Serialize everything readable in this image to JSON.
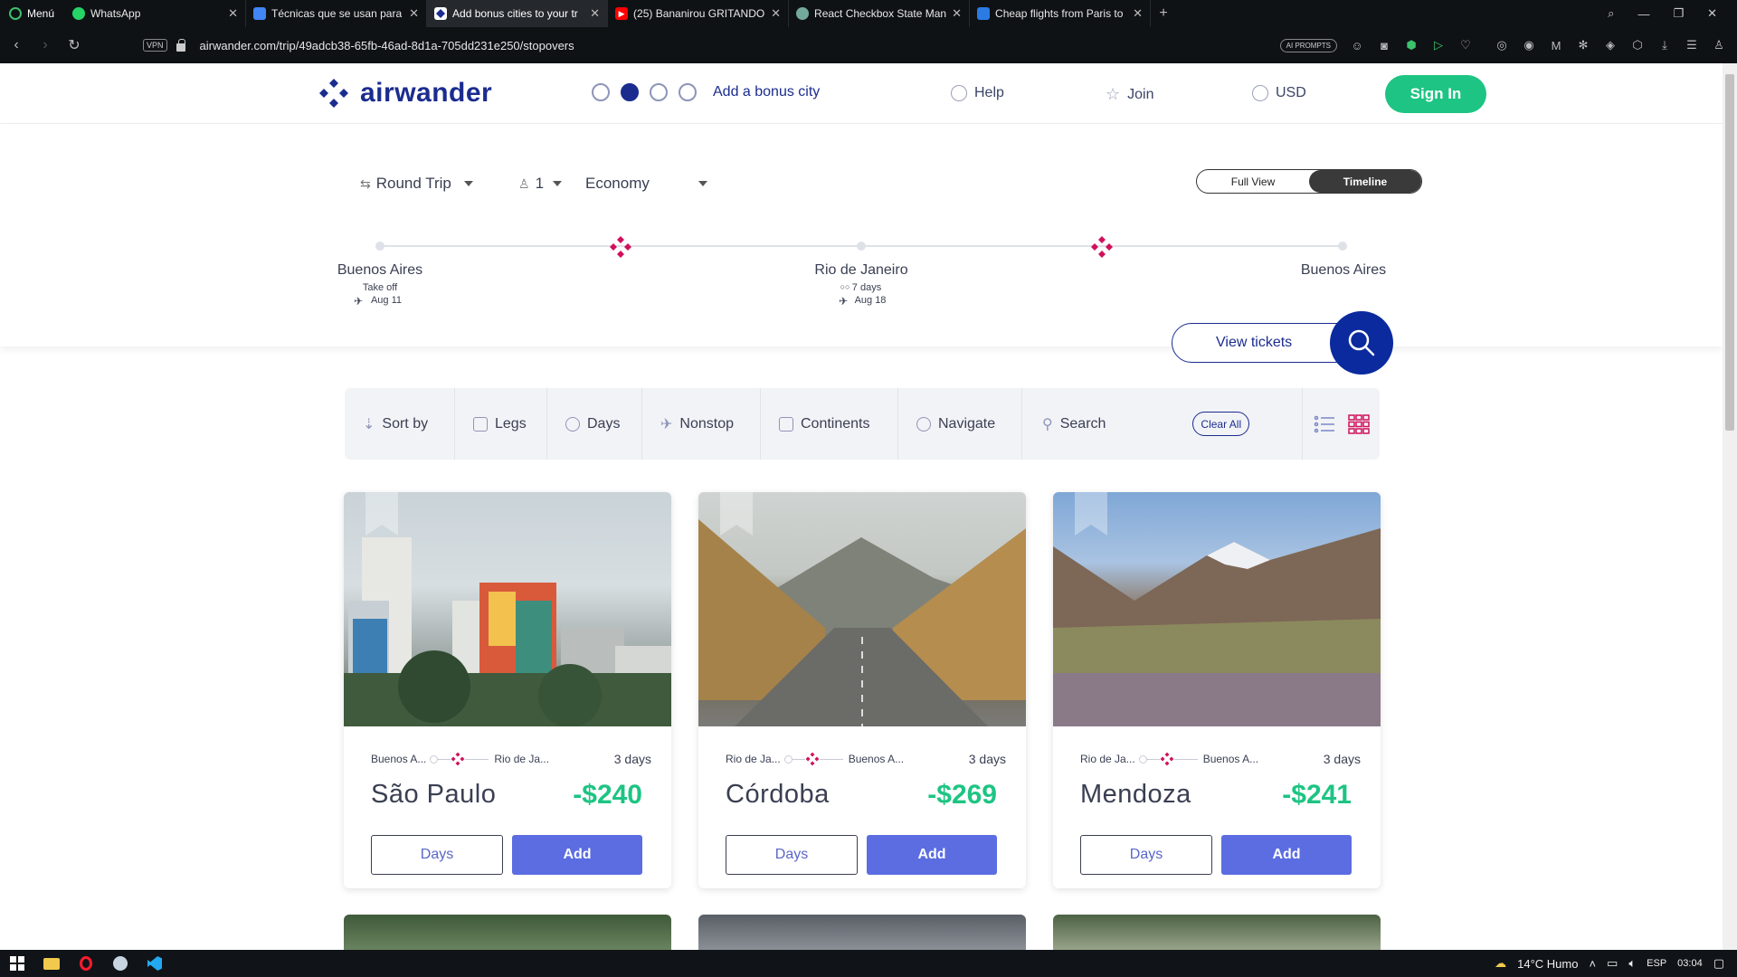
{
  "browser": {
    "menu_label": "Menú",
    "tabs": [
      {
        "label": "WhatsApp",
        "icon": "whatsapp-icon",
        "color": "#25d366",
        "active": false
      },
      {
        "label": "Técnicas que se usan para l",
        "icon": "docs-icon",
        "color": "#4285f4",
        "active": false
      },
      {
        "label": "Add bonus cities to your tr",
        "icon": "airwander-icon",
        "color": "#1b2c8f",
        "active": true
      },
      {
        "label": "(25) Bananirou GRITANDO",
        "icon": "youtube-icon",
        "color": "#ff0000",
        "active": false
      },
      {
        "label": "React Checkbox State Man",
        "icon": "chatgpt-icon",
        "color": "#74aa9c",
        "active": false
      },
      {
        "label": "Cheap flights from Paris to",
        "icon": "flights-icon",
        "color": "#2a7be4",
        "active": false
      }
    ],
    "url": "airwander.com/trip/49adcb38-65fb-46ad-8d1a-705dd231e250/stopovers",
    "vpn_label": "VPN",
    "ai_prompts_label": "AI PROMPTS"
  },
  "header": {
    "logo": "airwander",
    "bonus_link": "Add a bonus city",
    "help": "Help",
    "join": "Join",
    "currency": "USD",
    "signin": "Sign In"
  },
  "trip": {
    "trip_type": "Round Trip",
    "passengers": "1",
    "cabin": "Economy",
    "view_full": "Full View",
    "view_timeline": "Timeline",
    "stops": [
      {
        "city": "Buenos Aires",
        "line1": "Take off",
        "line2": "Aug 11"
      },
      {
        "city": "Rio de Janeiro",
        "line1": "7 days",
        "line2": "Aug 18"
      },
      {
        "city": "Buenos Aires",
        "line1": "",
        "line2": ""
      }
    ],
    "view_tickets": "View tickets"
  },
  "filters": {
    "sort_by": "Sort by",
    "legs": "Legs",
    "days": "Days",
    "nonstop": "Nonstop",
    "continents": "Continents",
    "navigate": "Navigate",
    "search": "Search",
    "clear_all": "Clear All"
  },
  "cards": [
    {
      "from": "Buenos A...",
      "to": "Rio de Ja...",
      "days": "3 days",
      "name": "São Paulo",
      "price": "-$240",
      "btn_days": "Days",
      "btn_add": "Add"
    },
    {
      "from": "Rio de Ja...",
      "to": "Buenos A...",
      "days": "3 days",
      "name": "Córdoba",
      "price": "-$269",
      "btn_days": "Days",
      "btn_add": "Add"
    },
    {
      "from": "Rio de Ja...",
      "to": "Buenos A...",
      "days": "3 days",
      "name": "Mendoza",
      "price": "-$241",
      "btn_days": "Days",
      "btn_add": "Add"
    }
  ],
  "taskbar": {
    "weather": "14°C  Humo",
    "lang": "ESP",
    "time": "03:04"
  },
  "colors": {
    "brand_blue": "#1b2c8f",
    "accent_pink": "#d0115c",
    "price_green": "#1ec483",
    "add_button": "#5b6de0"
  }
}
